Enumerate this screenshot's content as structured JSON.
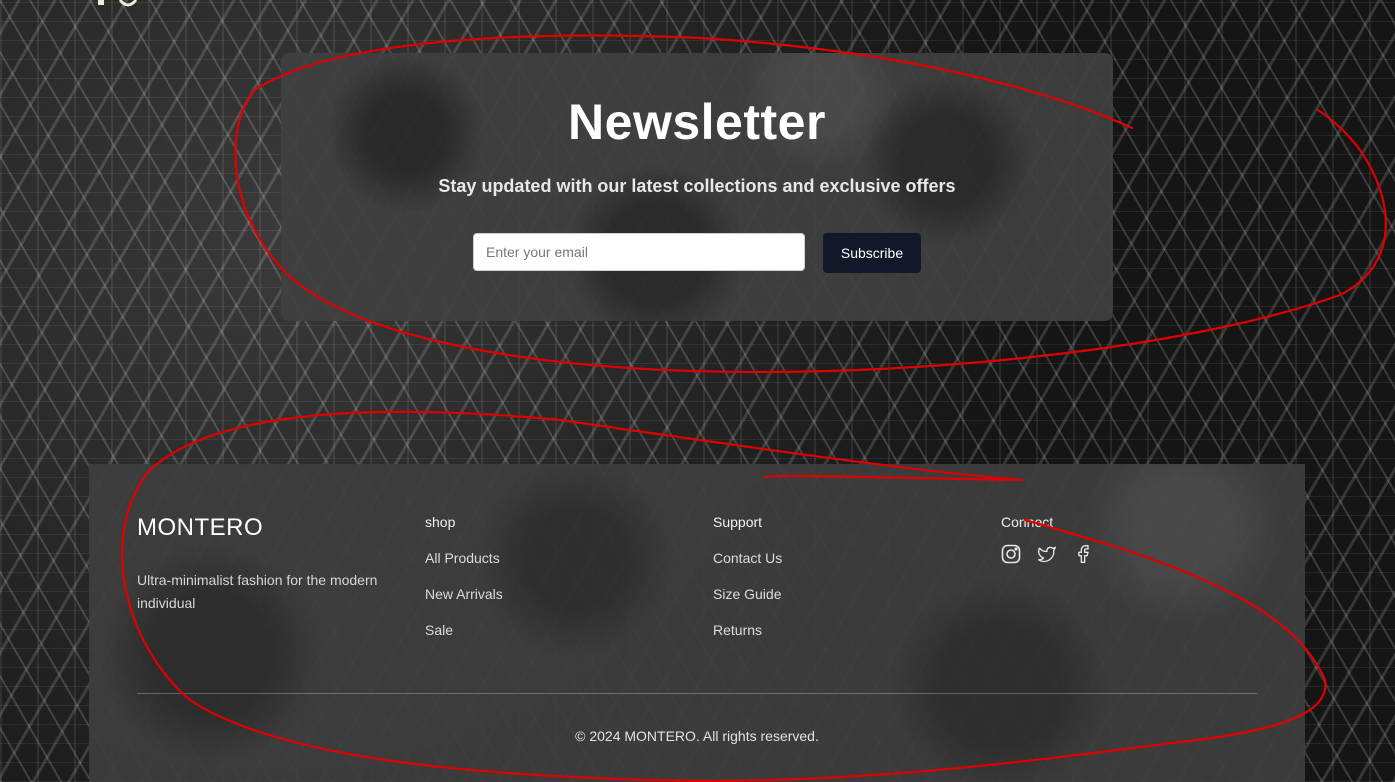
{
  "newsletter": {
    "title": "Newsletter",
    "subtitle": "Stay updated with our latest collections and exclusive offers",
    "email_placeholder": "Enter your email",
    "subscribe_label": "Subscribe",
    "button_color": "#111827"
  },
  "footer": {
    "brand": "MONTERO",
    "tagline": "Ultra-minimalist fashion for the modern individual",
    "columns": [
      {
        "heading": "shop",
        "links": [
          "All Products",
          "New Arrivals",
          "Sale"
        ]
      },
      {
        "heading": "Support",
        "links": [
          "Contact Us",
          "Size Guide",
          "Returns"
        ]
      },
      {
        "heading": "Connect",
        "icons": [
          "instagram-icon",
          "twitter-icon",
          "facebook-icon"
        ]
      }
    ],
    "copyright": "© 2024 MONTERO. All rights reserved."
  },
  "annotation_color": "#e00000"
}
